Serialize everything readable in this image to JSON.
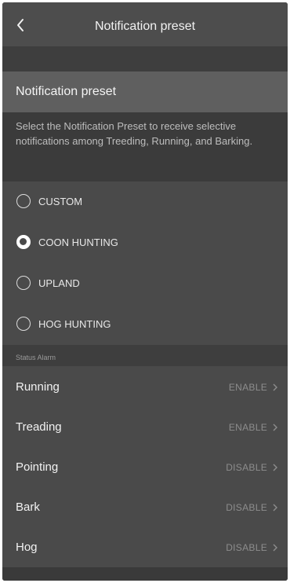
{
  "header": {
    "title": "Notification preset",
    "back_icon": "chevron-left-icon"
  },
  "section": {
    "title": "Notification preset",
    "description": "Select the Notification Preset to receive selective notifications among Treeding, Running, and Barking."
  },
  "presets": [
    {
      "label": "CUSTOM",
      "selected": false
    },
    {
      "label": "COON HUNTING",
      "selected": true
    },
    {
      "label": "UPLAND",
      "selected": false
    },
    {
      "label": "HOG HUNTING",
      "selected": false
    }
  ],
  "status_alarm": {
    "header": "Status Alarm",
    "items": [
      {
        "name": "Running",
        "value": "ENABLE"
      },
      {
        "name": "Treading",
        "value": "ENABLE"
      },
      {
        "name": "Pointing",
        "value": "DISABLE"
      },
      {
        "name": "Bark",
        "value": "DISABLE"
      },
      {
        "name": "Hog",
        "value": "DISABLE"
      }
    ]
  },
  "colors": {
    "background": "#4a4a4a",
    "text": "#f2f2f2",
    "muted": "#8d8d8d"
  }
}
